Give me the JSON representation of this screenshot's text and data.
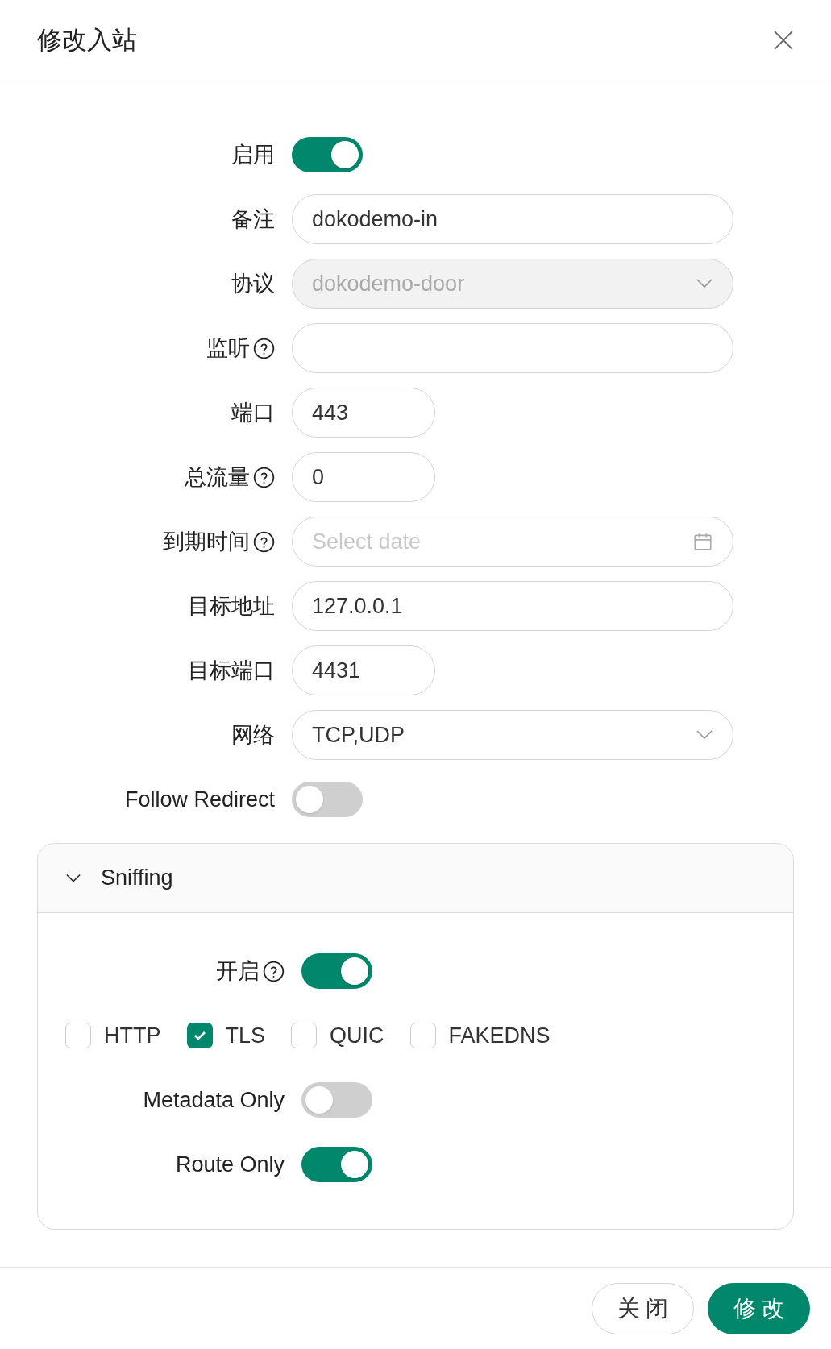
{
  "dialog": {
    "title": "修改入站",
    "fields": [
      {
        "kind": "switch",
        "label": "启用",
        "help": false,
        "on": true
      },
      {
        "kind": "input",
        "label": "备注",
        "help": false,
        "value": "dokodemo-in"
      },
      {
        "kind": "select",
        "label": "协议",
        "help": false,
        "value": "dokodemo-door",
        "disabled": true
      },
      {
        "kind": "input",
        "label": "监听",
        "help": true
      },
      {
        "kind": "short_input",
        "label": "端口",
        "help": false,
        "value": "443"
      },
      {
        "kind": "short_input",
        "label": "总流量",
        "help": true,
        "value": "0"
      },
      {
        "kind": "date",
        "label": "到期时间",
        "help": true,
        "placeholder": "Select date"
      },
      {
        "kind": "input",
        "label": "目标地址",
        "help": false,
        "value": "127.0.0.1"
      },
      {
        "kind": "short_input",
        "label": "目标端口",
        "help": false,
        "value": "4431"
      },
      {
        "kind": "select",
        "label": "网络",
        "help": false,
        "value": "TCP,UDP",
        "disabled": false
      },
      {
        "kind": "switch",
        "label": "Follow Redirect",
        "help": false,
        "on": false
      }
    ],
    "sniffing": {
      "title": "Sniffing",
      "expanded": true,
      "enable": {
        "label": "开启",
        "help": true,
        "on": true
      },
      "protocols": [
        {
          "label": "HTTP",
          "checked": false
        },
        {
          "label": "TLS",
          "checked": true
        },
        {
          "label": "QUIC",
          "checked": false
        },
        {
          "label": "FAKEDNS",
          "checked": false
        }
      ],
      "switches": [
        {
          "label": "Metadata Only",
          "on": false
        },
        {
          "label": "Route Only",
          "on": true
        }
      ]
    },
    "buttons": [
      {
        "kind": "default",
        "label": "关 闭"
      },
      {
        "kind": "primary",
        "label": "修 改"
      }
    ]
  }
}
